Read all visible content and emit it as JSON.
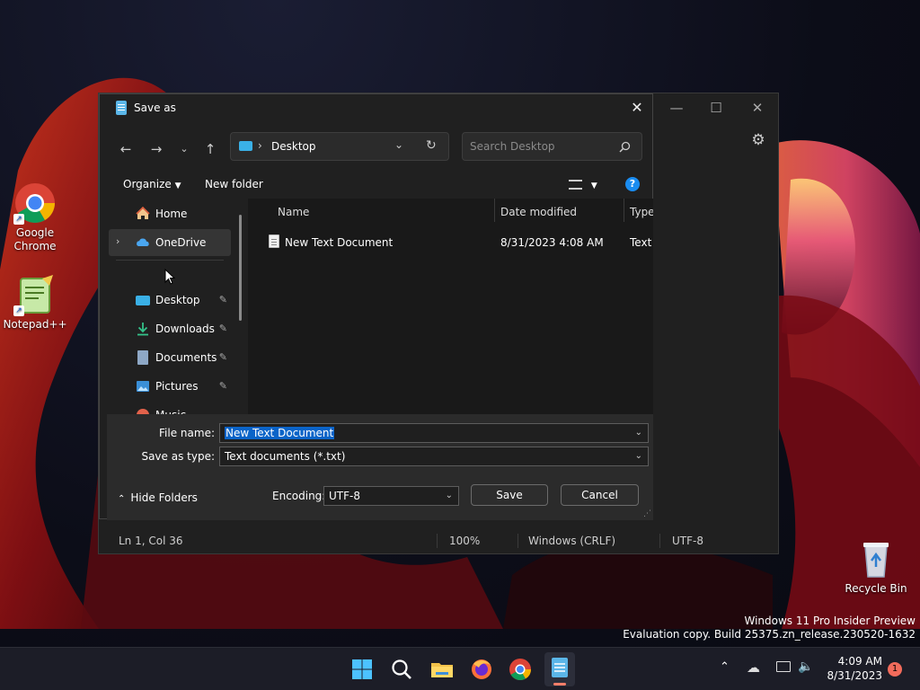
{
  "desktop": {
    "icons": [
      {
        "label_line1": "Google",
        "label_line2": "Chrome"
      },
      {
        "label_line1": "Notepad++",
        "label_line2": ""
      },
      {
        "label_line1": "Recycle Bin",
        "label_line2": ""
      }
    ],
    "watermark": {
      "line1": "Windows 11 Pro Insider Preview",
      "line2": "Evaluation copy. Build 25375.zn_release.230520-1632"
    }
  },
  "notepad": {
    "status": {
      "position": "Ln 1, Col 36",
      "zoom": "100%",
      "line_ending": "Windows (CRLF)",
      "encoding": "UTF-8"
    }
  },
  "dialog": {
    "title": "Save as",
    "address": {
      "location": "Desktop",
      "separator": "›"
    },
    "search_placeholder": "Search Desktop",
    "toolbar": {
      "organize": "Organize",
      "new_folder": "New folder"
    },
    "sidebar": {
      "home": "Home",
      "onedrive": "OneDrive",
      "desktop": "Desktop",
      "downloads": "Downloads",
      "documents": "Documents",
      "pictures": "Pictures",
      "music": "Music"
    },
    "columns": {
      "name": "Name",
      "date": "Date modified",
      "type": "Type"
    },
    "files": [
      {
        "name": "New Text Document",
        "date": "8/31/2023 4:08 AM",
        "type": "Text Document"
      }
    ],
    "file_name_label": "File name:",
    "file_name_value": "New Text Document",
    "save_type_label": "Save as type:",
    "save_type_value": "Text documents (*.txt)",
    "hide_folders": "Hide Folders",
    "encoding_label": "Encoding:",
    "encoding_value": "UTF-8",
    "save": "Save",
    "cancel": "Cancel"
  },
  "taskbar": {
    "time": "4:09 AM",
    "date": "8/31/2023",
    "notification_count": "1"
  }
}
